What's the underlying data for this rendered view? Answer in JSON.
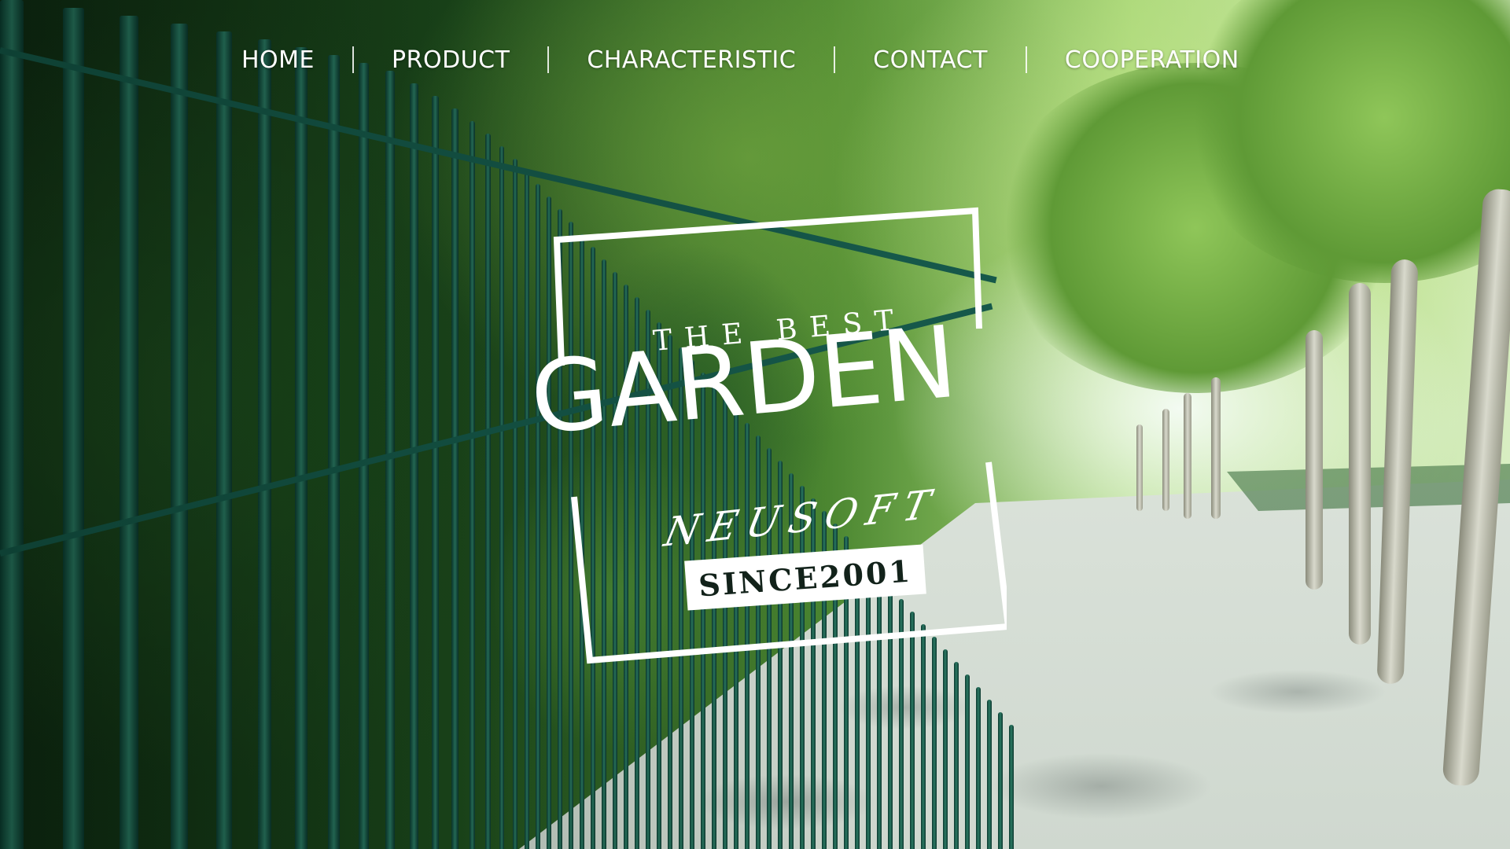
{
  "nav": {
    "items": [
      {
        "label": "HOME"
      },
      {
        "label": "PRODUCT"
      },
      {
        "label": "CHARACTERISTIC"
      },
      {
        "label": "CONTACT"
      },
      {
        "label": "COOPERATION"
      }
    ]
  },
  "hero": {
    "tagline": "THE BEST",
    "title": "GARDEN",
    "brand": "NEUSOFT",
    "since": "SINCE2001"
  },
  "colors": {
    "text": "#ffffff",
    "badge_bg": "#ffffff",
    "badge_text": "#12221a",
    "fence": "#1f6b58",
    "foliage": "#5f9a36"
  }
}
